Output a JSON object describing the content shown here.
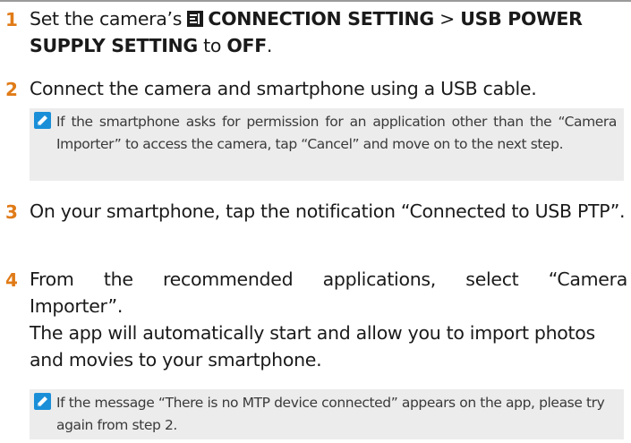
{
  "steps": [
    {
      "number": "1",
      "pre": "Set the camera’s ",
      "menu": "CONNECTION SETTING",
      "sep": " > ",
      "setting": "USB POWER SUPPLY SETTING",
      "to": " to ",
      "value": "OFF",
      "end": "."
    },
    {
      "number": "2",
      "text": "Connect the camera and smartphone using a USB cable."
    },
    {
      "number": "3",
      "text": "On your smartphone, tap the notification “Connected to USB PTP”."
    },
    {
      "number": "4",
      "text_line1": "From the recommended applications, select “Camera",
      "text_line2": "Importer”.",
      "text2": "The app will automatically start and allow you to import photos and movies to your smartphone."
    }
  ],
  "notes": {
    "note1": "If the smartphone asks for permission for an application other than the “Camera Importer” to access the camera, tap “Cancel” and move on to the next step.",
    "note2": "If the message “There is no MTP device connected” appears on the app, please try again from step 2."
  },
  "icons": {
    "menu_icon": "connection-setting-icon",
    "note_icon": "note-pencil-icon"
  },
  "colors": {
    "step_number": "#e07b17",
    "note_background": "#ececec",
    "note_icon": "#1a8fd8"
  }
}
